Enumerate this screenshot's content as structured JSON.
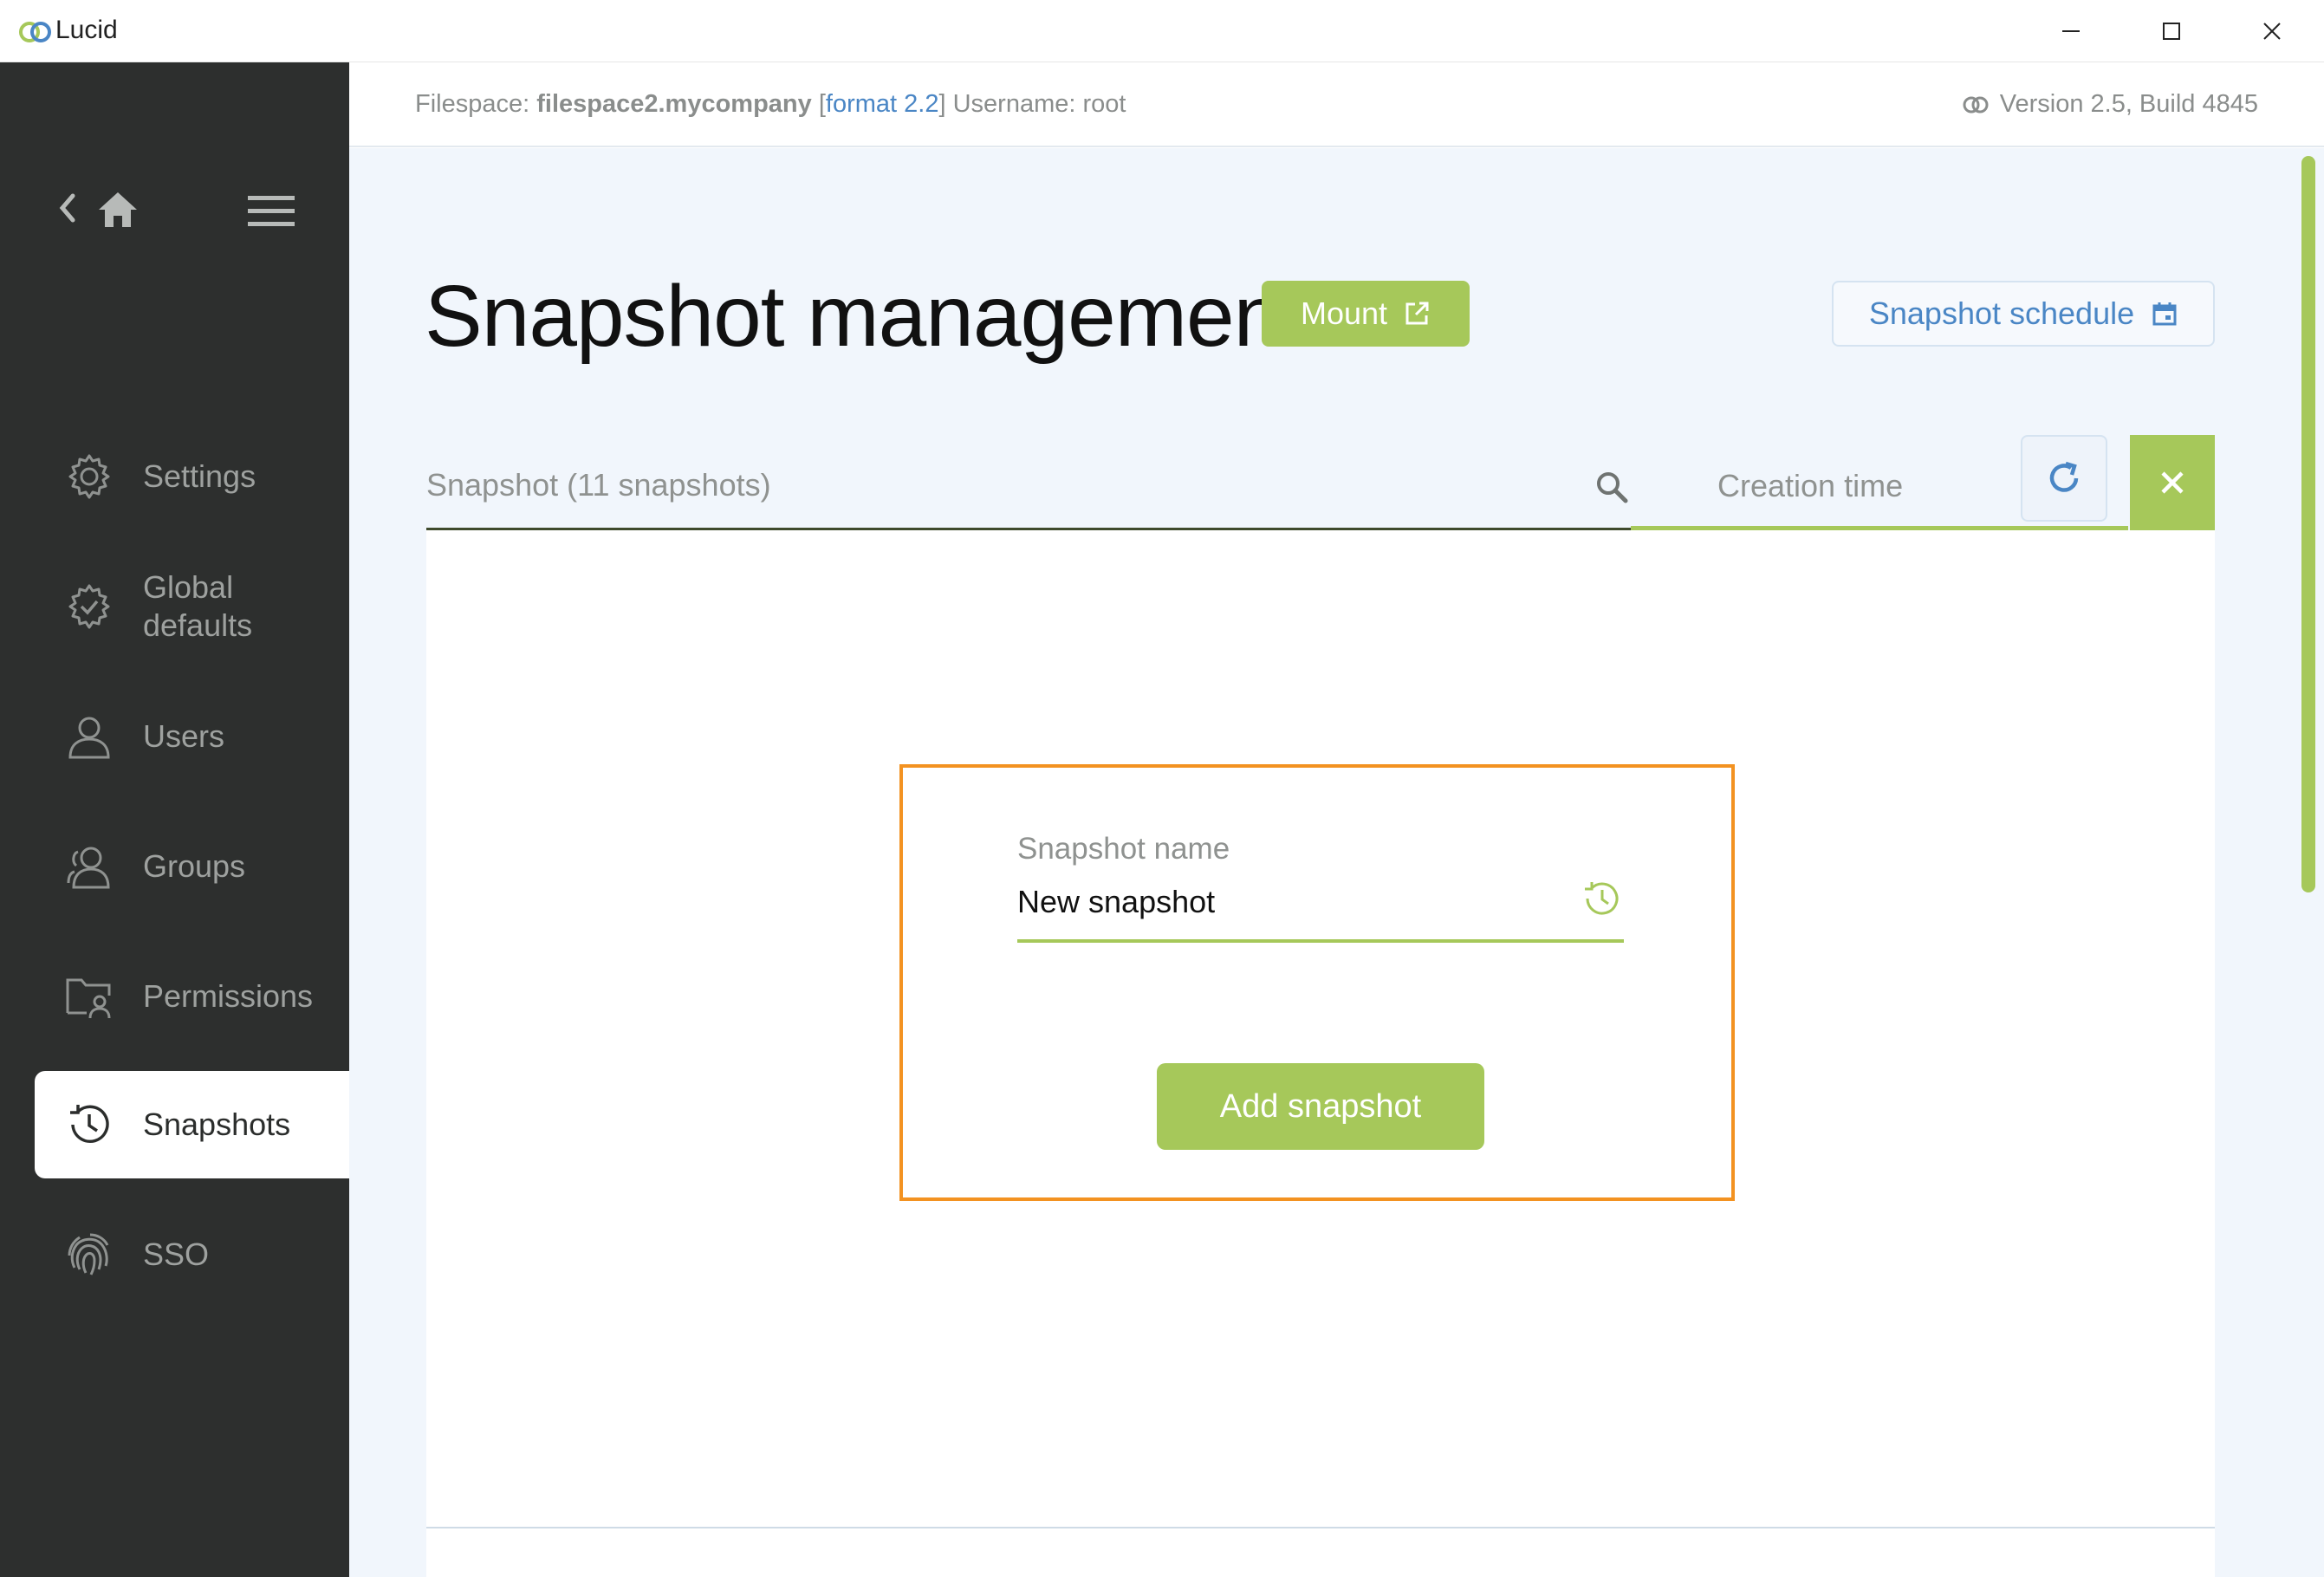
{
  "window": {
    "title": "Lucid"
  },
  "colors": {
    "accent": "#a6c85a",
    "sidebar": "#2d2f2e",
    "link": "#4a86c5",
    "highlight": "#f39221"
  },
  "sidebar": {
    "items": [
      {
        "label": "Settings",
        "icon": "gear-icon"
      },
      {
        "label": "Global defaults",
        "icon": "gear-check-icon"
      },
      {
        "label": "Users",
        "icon": "user-icon"
      },
      {
        "label": "Groups",
        "icon": "group-icon"
      },
      {
        "label": "Permissions",
        "icon": "folder-user-icon"
      },
      {
        "label": "Snapshots",
        "icon": "history-icon",
        "active": true
      },
      {
        "label": "SSO",
        "icon": "fingerprint-icon"
      }
    ]
  },
  "header": {
    "filespace_label": "Filespace:",
    "filespace_name": "filespace2.mycompany",
    "format": "format 2.2",
    "username": "Username: root",
    "version": "Version 2.5, Build 4845"
  },
  "page": {
    "title": "Snapshot management",
    "mount_label": "Mount",
    "schedule_label": "Snapshot schedule"
  },
  "search": {
    "placeholder": "Snapshot (11 snapshots)",
    "sort_label": "Creation time"
  },
  "add_form": {
    "field_label": "Snapshot name",
    "field_value": "New snapshot",
    "button_label": "Add snapshot"
  }
}
